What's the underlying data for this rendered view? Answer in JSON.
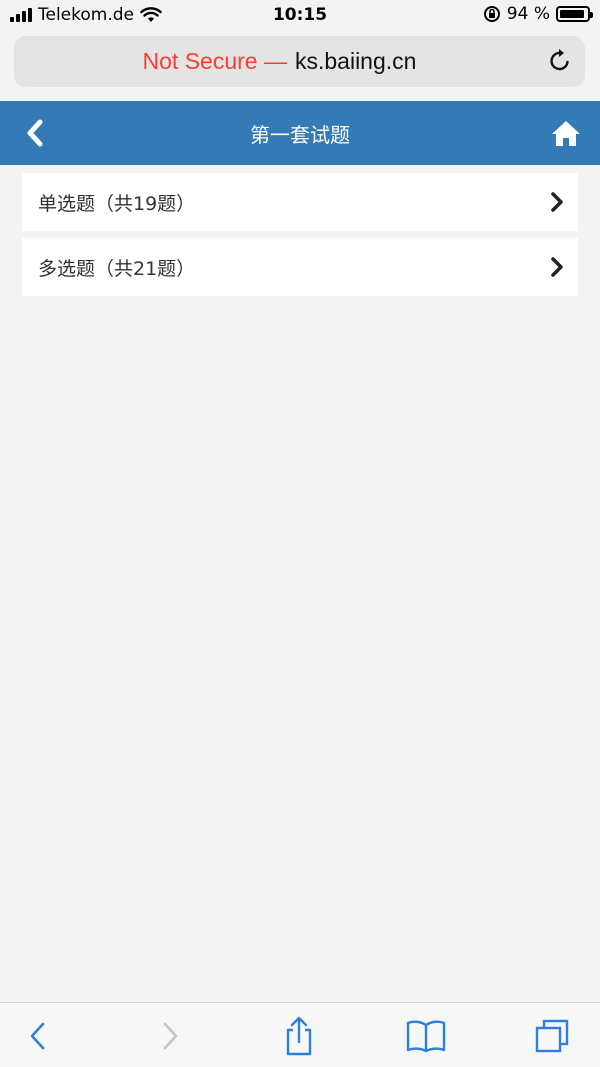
{
  "status_bar": {
    "carrier": "Telekom.de",
    "time": "10:15",
    "battery_text": "94 %",
    "battery_level": 0.94
  },
  "browser": {
    "not_secure": "Not Secure —",
    "domain": "ks.baiing.cn"
  },
  "header": {
    "title": "第一套试题"
  },
  "list": {
    "items": [
      {
        "label": "单选题（共19题）"
      },
      {
        "label": "多选题（共21题）"
      }
    ]
  },
  "colors": {
    "header_bg": "#337ab7",
    "page_bg": "#f3f3f3",
    "not_secure": "#ff3b30",
    "toolbar_accent": "#2f7fd8"
  },
  "icons": {
    "back": "chevron-left-icon",
    "home": "home-icon",
    "list_arrow": "chevron-right-icon",
    "reload": "reload-icon",
    "share": "share-icon",
    "bookmarks": "book-icon",
    "tabs": "tabs-icon"
  }
}
